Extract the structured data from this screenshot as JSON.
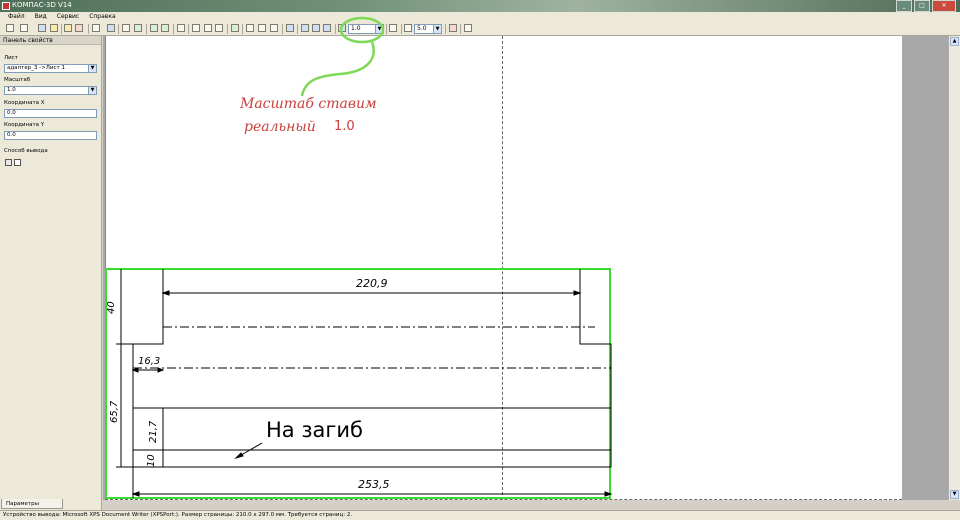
{
  "window": {
    "title": "КОМПАС-3D V14"
  },
  "menu": [
    "Файл",
    "Вид",
    "Сервис",
    "Справка"
  ],
  "toolbar": {
    "scale_value": "1.0",
    "step_value": "5.0"
  },
  "panel": {
    "header": "Панель свойств",
    "sheet_label": "Лист",
    "sheet_value": "адаптер_3 ->Лист 1",
    "scale_label": "Масштаб",
    "scale_value": "1.0",
    "x_label": "Координата X",
    "x_value": "0.0",
    "y_label": "Координата Y",
    "y_value": "0.0",
    "output_label": "Способ вывода",
    "tab_label": "Параметры просмотра"
  },
  "annotation": {
    "line1": "Масштаб ставим",
    "line2": "реальный",
    "value": "1.0"
  },
  "drawing": {
    "dims": {
      "top_width": "220,9",
      "left_top": "40",
      "left_small": "16,3",
      "left_total": "65,7",
      "mid": "21,7",
      "bottom": "10",
      "bottom_width": "253,5"
    },
    "fold_label": "На загиб"
  },
  "status": {
    "text": "Устройство вывода: Microsoft XPS Document Writer (XPSPort:). Размер страницы: 210.0 x 297.0 мм. Требуется страниц: 2."
  },
  "colors": {
    "annotation": "#c8403c",
    "highlight": "#3bdc2f"
  }
}
